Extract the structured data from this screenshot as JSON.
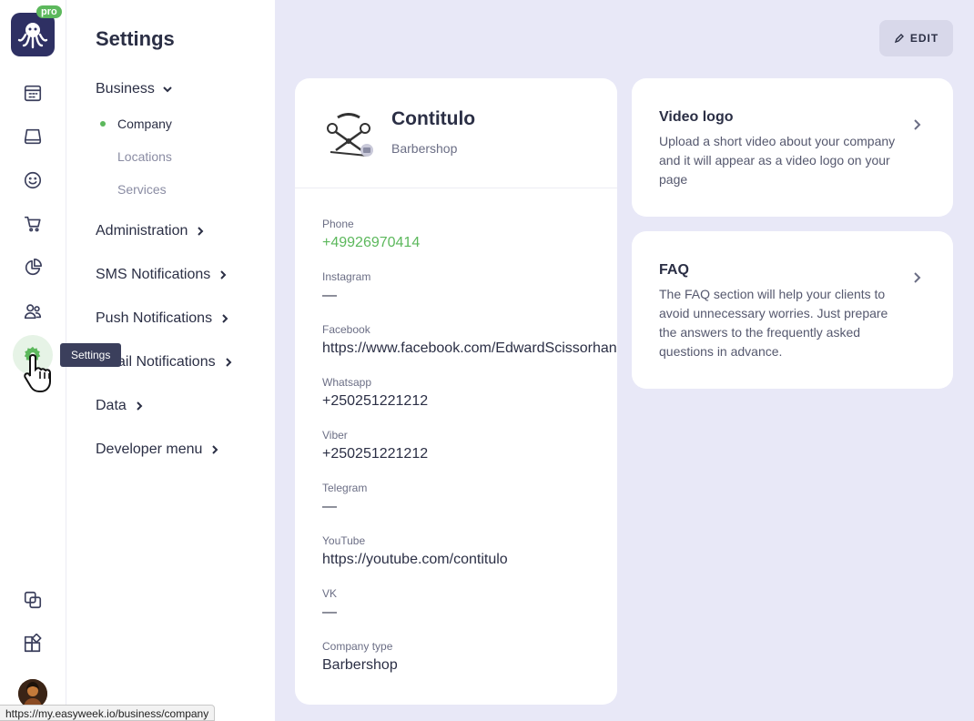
{
  "rail": {
    "pro_badge": "pro",
    "tooltip": "Settings",
    "icons": [
      "calendar-icon",
      "inbox-icon",
      "smiley-icon",
      "cart-icon",
      "pie-chart-icon",
      "users-icon",
      "gear-icon",
      "copy-icon",
      "widgets-icon"
    ]
  },
  "status_url": "https://my.easyweek.io/business/company",
  "menu": {
    "title": "Settings",
    "business": "Business",
    "company": "Company",
    "locations": "Locations",
    "services": "Services",
    "administration": "Administration",
    "sms": "SMS Notifications",
    "push": "Push Notifications",
    "email": "Email Notifications",
    "data": "Data",
    "developer": "Developer menu"
  },
  "edit_label": "EDIT",
  "company": {
    "name": "Contitulo",
    "type": "Barbershop",
    "fields": [
      {
        "label": "Phone",
        "value": "+49926970414"
      },
      {
        "label": "Instagram",
        "value": "—"
      },
      {
        "label": "Facebook",
        "value": "https://www.facebook.com/EdwardScissorhand"
      },
      {
        "label": "Whatsapp",
        "value": "+250251221212"
      },
      {
        "label": "Viber",
        "value": "+250251221212"
      },
      {
        "label": "Telegram",
        "value": "—"
      },
      {
        "label": "YouTube",
        "value": "https://youtube.com/contitulo"
      },
      {
        "label": "VK",
        "value": "—"
      },
      {
        "label": "Company type",
        "value": "Barbershop"
      }
    ]
  },
  "video_logo": {
    "title": "Video logo",
    "desc": "Upload a short video about your company and it will appear as a video logo on your page"
  },
  "faq": {
    "title": "FAQ",
    "desc": "The FAQ section will help your clients to avoid unnecessary worries. Just prepare the answers to the frequently asked questions in advance."
  },
  "colors": {
    "accent": "#5cb85c",
    "brand": "#2e3063",
    "background": "#e8e8f7"
  }
}
